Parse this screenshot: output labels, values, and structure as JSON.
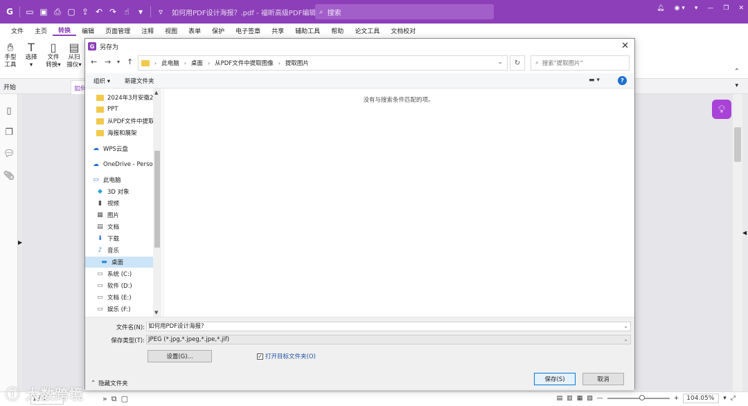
{
  "titlebar": {
    "doc_title": "如何用PDF设计海报？.pdf - 福昕高级PDF编辑器",
    "search_placeholder": "搜索"
  },
  "menu": [
    "文件",
    "主页",
    "转换",
    "编辑",
    "页面管理",
    "注释",
    "视图",
    "表单",
    "保护",
    "电子签章",
    "共享",
    "辅助工具",
    "帮助",
    "论文工具",
    "文档校对"
  ],
  "ribbon": {
    "hand_tool": [
      "手型",
      "工具"
    ],
    "select_tool": [
      "选择",
      ""
    ],
    "file_convert": [
      "文件",
      "转换▾"
    ],
    "scan": [
      "从扫",
      "描仪▾"
    ]
  },
  "tabs": {
    "start": "开始",
    "doc": "如何"
  },
  "dialog": {
    "title": "另存为",
    "breadcrumb": [
      "此电脑",
      "桌面",
      "从PDF文件中提取图像",
      "提取图片"
    ],
    "search_placeholder": "搜索\"提取图片\"",
    "organize": "组织 ▾",
    "new_folder": "新建文件夹",
    "empty_message": "没有与搜索条件匹配的项。",
    "nav_items": [
      {
        "label": "2024年3月安徽2",
        "type": "folder"
      },
      {
        "label": "PPT",
        "type": "folder"
      },
      {
        "label": "从PDF文件中提取",
        "type": "folder"
      },
      {
        "label": "海报和展架",
        "type": "folder"
      },
      {
        "label": "WPS云盘",
        "type": "cloud"
      },
      {
        "label": "OneDrive - Perso",
        "type": "cloud"
      },
      {
        "label": "此电脑",
        "type": "pc"
      },
      {
        "label": "3D 对象",
        "type": "3d"
      },
      {
        "label": "视频",
        "type": "video"
      },
      {
        "label": "图片",
        "type": "picture"
      },
      {
        "label": "文档",
        "type": "doc"
      },
      {
        "label": "下载",
        "type": "download"
      },
      {
        "label": "音乐",
        "type": "music"
      },
      {
        "label": "桌面",
        "type": "desktop",
        "selected": true
      },
      {
        "label": "系统 (C:)",
        "type": "drive"
      },
      {
        "label": "软件 (D:)",
        "type": "drive"
      },
      {
        "label": "文档 (E:)",
        "type": "drive"
      },
      {
        "label": "娱乐 (F:)",
        "type": "drive"
      }
    ],
    "filename_label": "文件名(N):",
    "filename_value": "如何用PDF设计海报?",
    "filetype_label": "保存类型(T):",
    "filetype_value": "JPEG (*.jpg,*.jpeg,*.jpe,*.jif)",
    "settings_button": "设置(G)...",
    "open_folder_label": "打开目标文件夹(O)",
    "open_folder_checked": true,
    "hide_folders": "隐藏文件夹",
    "save_button": "保存(S)",
    "cancel_button": "取消"
  },
  "statusbar": {
    "page": "1 / 4",
    "zoom": "104.05%",
    "watermark": "大数跨境"
  },
  "colors": {
    "brand": "#8c3fb8",
    "bulb": "#a942d6",
    "selected": "#cce4f7"
  }
}
